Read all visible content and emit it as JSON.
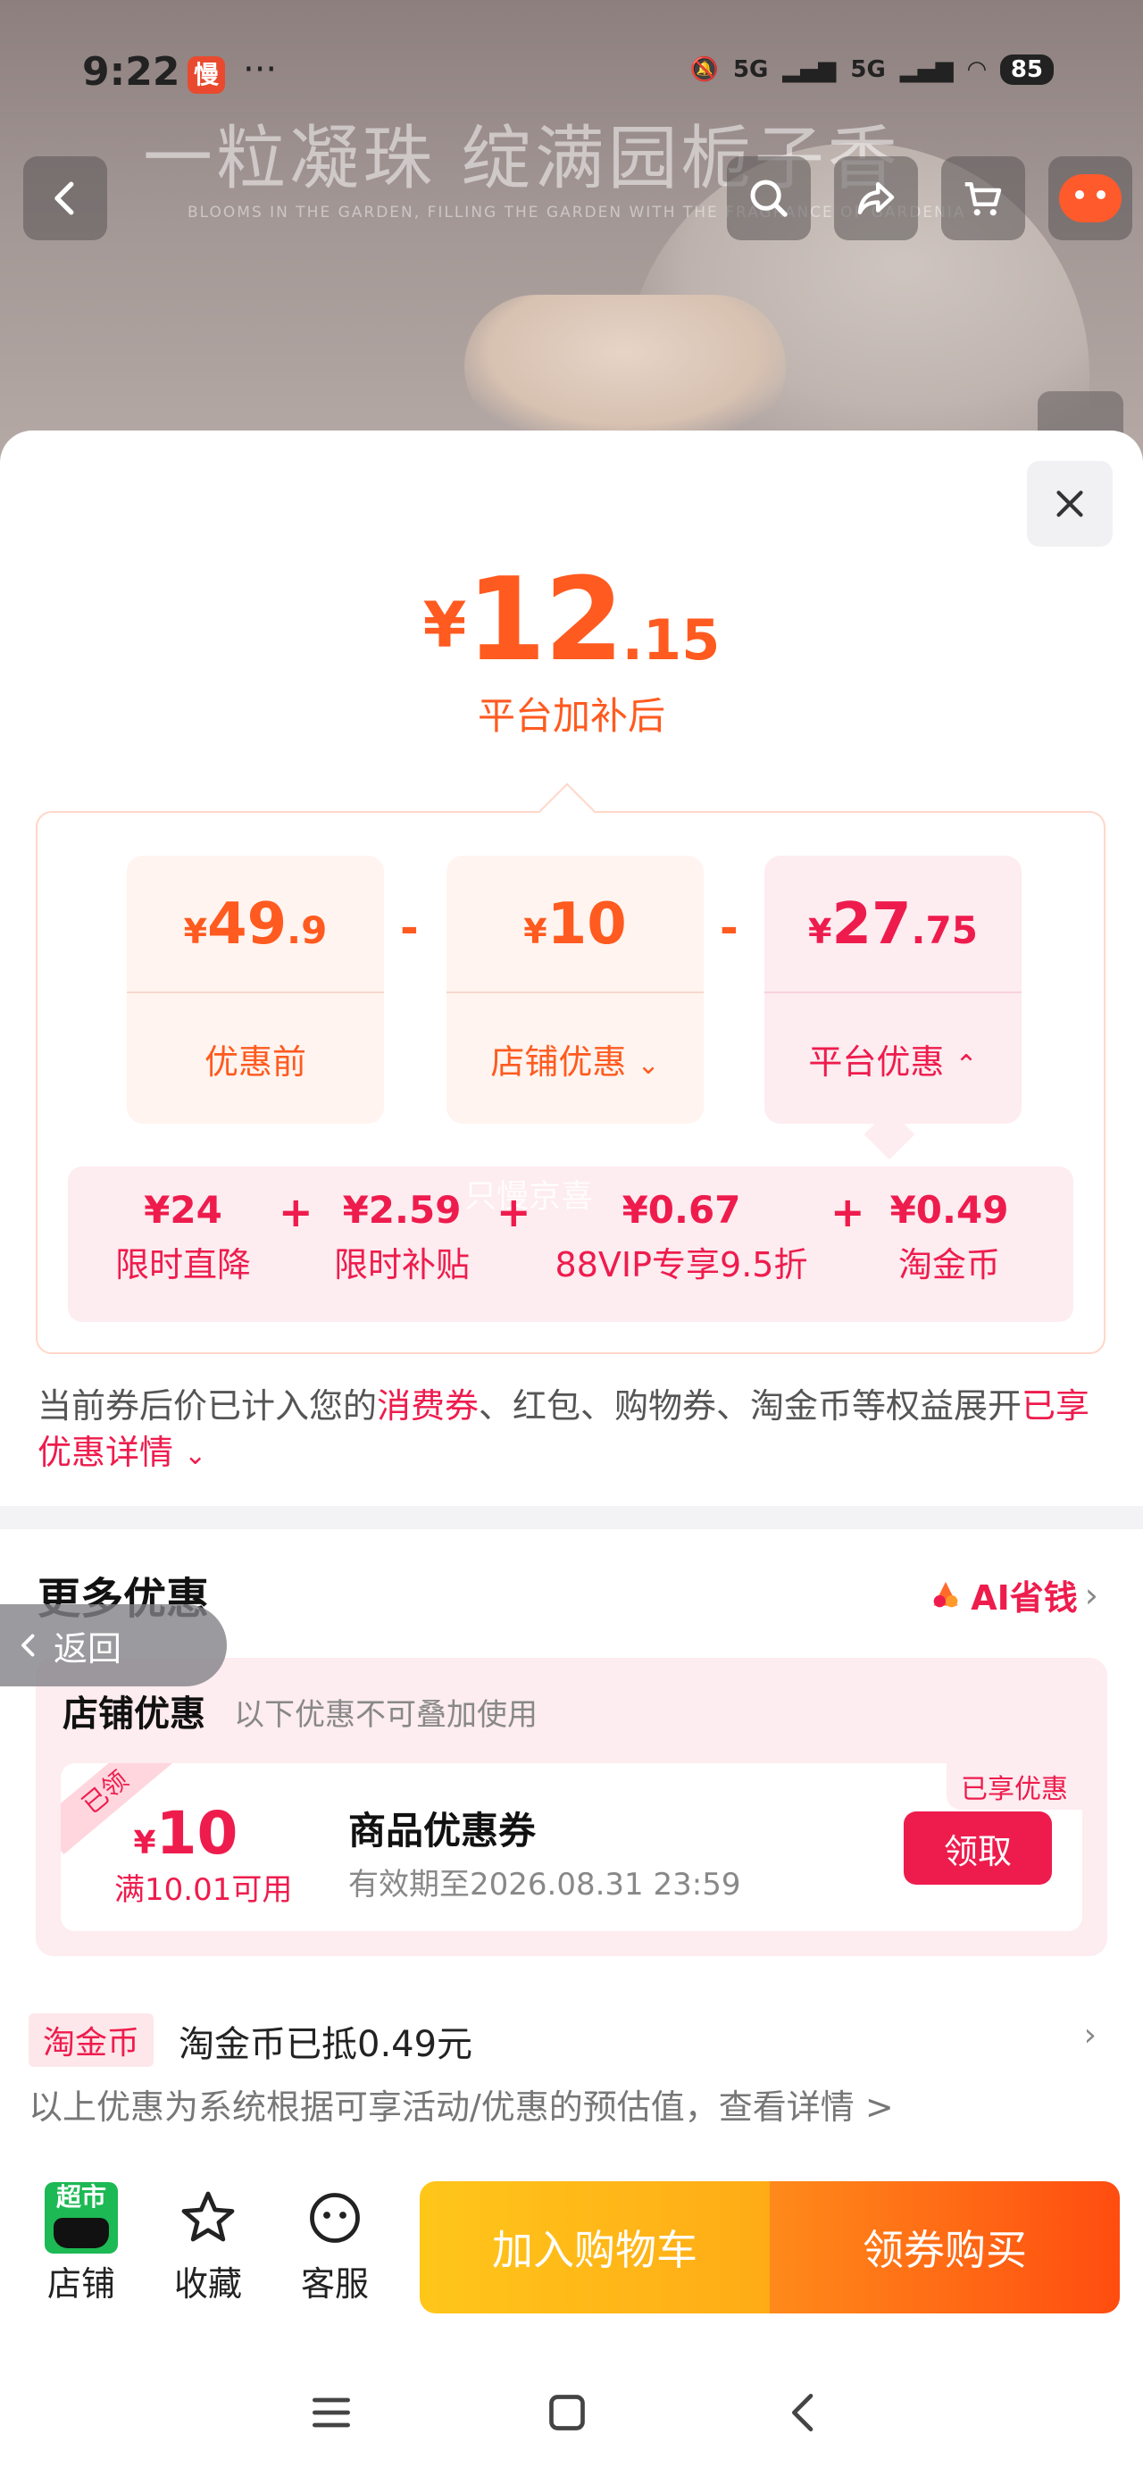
{
  "status_bar": {
    "time": "9:22",
    "slow_badge": "慢",
    "more": "···",
    "network_1": "5G",
    "network_2": "5G",
    "battery": "85"
  },
  "banner": {
    "title": "一粒凝珠 绽满园栀子香",
    "subtitle": "BLOOMS IN THE GARDEN, FILLING THE GARDEN WITH THE FRAGRANCE OF GARDENIA"
  },
  "price": {
    "currency": "¥",
    "integer": "12",
    "decimal": ".15",
    "caption": "平台加补后"
  },
  "breakdown": {
    "original": {
      "currency": "¥",
      "integer": "49",
      "decimal": ".9",
      "label": "优惠前"
    },
    "store": {
      "currency": "¥",
      "integer": "10",
      "decimal": "",
      "label": "店铺优惠"
    },
    "platform": {
      "currency": "¥",
      "integer": "27",
      "decimal": ".75",
      "label": "平台优惠"
    },
    "minus": "-",
    "sub_items": [
      {
        "value": "¥24",
        "label": "限时直降"
      },
      {
        "value": "¥2.59",
        "label": "限时补贴"
      },
      {
        "value": "¥0.67",
        "label": "88VIP专享9.5折"
      },
      {
        "value": "¥0.49",
        "label": "淘金币"
      }
    ],
    "plus": "+",
    "watermark": "只慢京喜"
  },
  "notice": {
    "part1": "当前券后价已计入您的",
    "highlight1": "消费券",
    "part2": "、红包、购物券、淘金币等权益展开",
    "highlight2": "已享优惠详情",
    "chevron": "⌄"
  },
  "more": {
    "title": "更多优惠",
    "ai_label": "AI省钱",
    "ai_arrow": "›"
  },
  "back_float": {
    "label": "返回"
  },
  "shop_discount": {
    "title": "店铺优惠",
    "note": "以下优惠不可叠加使用",
    "coupon": {
      "ribbon": "已领",
      "currency": "¥",
      "amount": "10",
      "condition": "满10.01可用",
      "name": "商品优惠券",
      "expiry": "有效期至2026.08.31 23:59",
      "enjoyed": "已享优惠",
      "button": "领取"
    }
  },
  "taojinbi": {
    "tag": "淘金币",
    "text": "淘金币已抵0.49元",
    "arrow": "›"
  },
  "estimate_note": "以上优惠为系统根据可享活动/优惠的预估值，查看详情 >",
  "bottom_bar": {
    "store": {
      "icon_text": "超市",
      "label": "店铺"
    },
    "favorite": {
      "label": "收藏"
    },
    "service": {
      "label": "客服"
    },
    "add_cart": "加入购物车",
    "buy": "领券购买"
  },
  "colors": {
    "accent_orange": "#ff5a1f",
    "accent_red": "#ee1c4d",
    "store_green": "#1db954"
  }
}
